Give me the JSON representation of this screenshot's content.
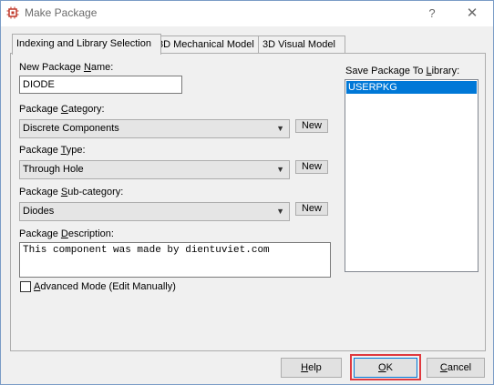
{
  "window": {
    "title": "Make Package",
    "help_glyph": "?",
    "close_glyph": "✕"
  },
  "tabs": [
    {
      "label": "Indexing and Library Selection",
      "active": true
    },
    {
      "label": "3D Mechanical Model",
      "active": false
    },
    {
      "label": "3D Visual Model",
      "active": false
    }
  ],
  "form": {
    "package_name": {
      "label_pre": "New Package ",
      "label_ul": "N",
      "label_post": "ame:",
      "value": "DIODE"
    },
    "category": {
      "label_pre": "Package ",
      "label_ul": "C",
      "label_post": "ategory:",
      "value": "Discrete Components"
    },
    "type": {
      "label_pre": "Package ",
      "label_ul": "T",
      "label_post": "ype:",
      "value": "Through Hole"
    },
    "subcategory": {
      "label_pre": "Package ",
      "label_ul": "S",
      "label_post": "ub-category:",
      "value": "Diodes"
    },
    "description": {
      "label_pre": "Package ",
      "label_ul": "D",
      "label_post": "escription:",
      "value": "This component was made by dientuviet.com"
    },
    "new_button_label": "New",
    "advanced_mode": {
      "label_ul": "A",
      "label_post": "dvanced Mode (Edit Manually)",
      "checked": false
    }
  },
  "library": {
    "label_pre": "Save Package To ",
    "label_ul": "L",
    "label_post": "ibrary:",
    "items": [
      "USERPKG"
    ],
    "selected": "USERPKG"
  },
  "buttons": {
    "help": {
      "ul": "H",
      "rest": "elp"
    },
    "ok": {
      "ul": "O",
      "rest": "K"
    },
    "cancel": {
      "ul": "C",
      "rest": "ancel"
    }
  },
  "colors": {
    "selection": "#0078d7",
    "highlight_box": "#e0393e"
  },
  "icons": {
    "app": "chip-icon",
    "dropdown": "chevron-down-icon",
    "close": "close-icon",
    "help": "help-icon"
  }
}
